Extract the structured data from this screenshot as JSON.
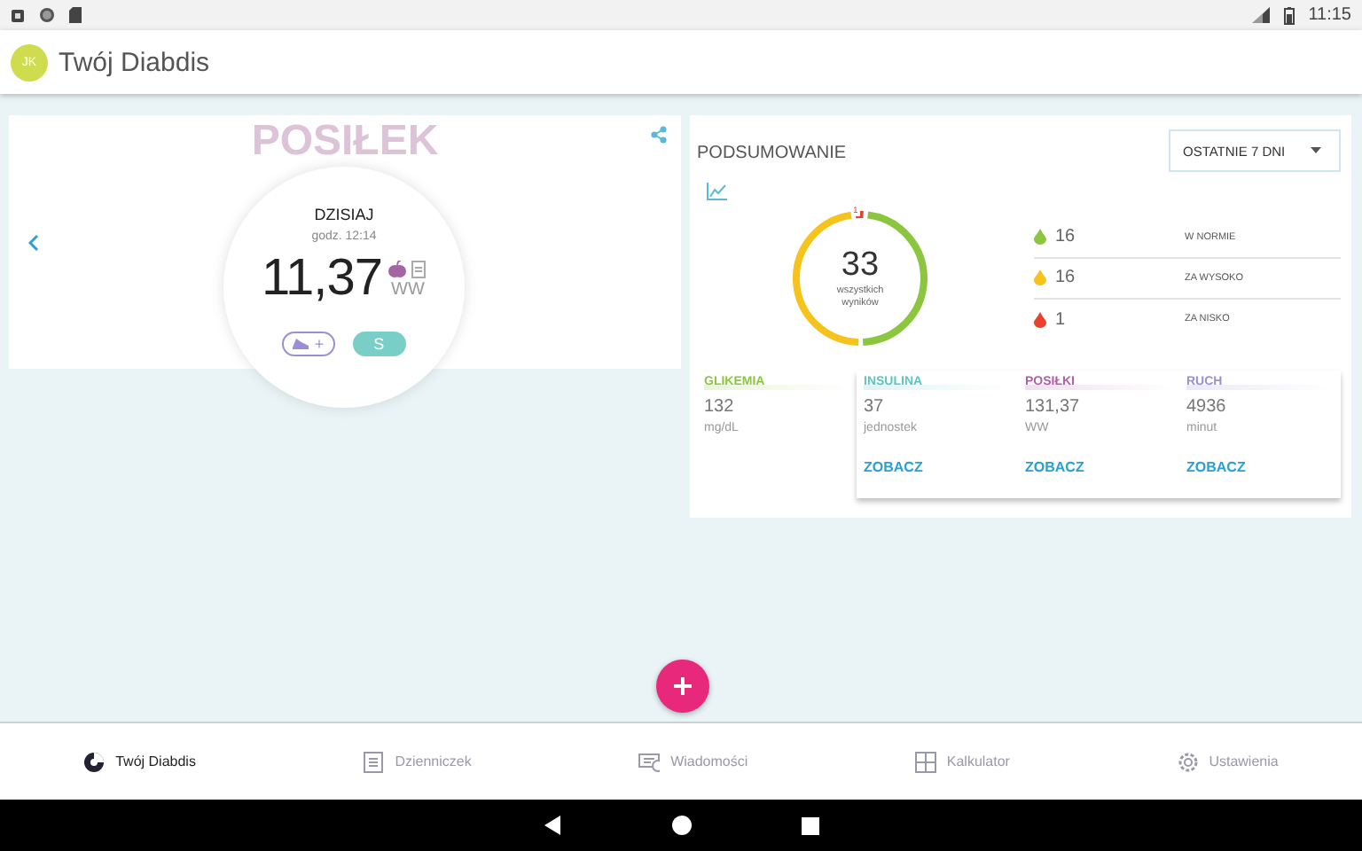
{
  "status_bar": {
    "time": "11:15"
  },
  "app_bar": {
    "avatar": "JK",
    "title": "Twój Diabdis"
  },
  "entry_card": {
    "category": "POSIŁEK",
    "day": "DZISIAJ",
    "time": "godz. 12:14",
    "value": "11,37",
    "unit": "WW",
    "tags": [
      {
        "kind": "activity",
        "label": "+"
      },
      {
        "kind": "note",
        "label": "S"
      }
    ]
  },
  "summary": {
    "title": "PODSUMOWANIE",
    "period": "OSTATNIE 7 DNI",
    "total": "33",
    "total_label": "wszystkich wyników",
    "ring_label": "1",
    "ranges": [
      {
        "count": "16",
        "label": "W NORMIE",
        "color": "#8cc63f"
      },
      {
        "count": "16",
        "label": "ZA WYSOKO",
        "color": "#f6c21c"
      },
      {
        "count": "1",
        "label": "ZA NISKO",
        "color": "#e8412c"
      }
    ],
    "metrics": [
      {
        "title": "GLIKEMIA",
        "value": "132",
        "unit": "mg/dL",
        "color": "#8cc63f"
      },
      {
        "title": "INSULINA",
        "value": "37",
        "unit": "jednostek",
        "color": "#5fc4c0",
        "link": "ZOBACZ"
      },
      {
        "title": "POSIŁKI",
        "value": "131,37",
        "unit": "WW",
        "color": "#b05ea8",
        "link": "ZOBACZ"
      },
      {
        "title": "RUCH",
        "value": "4936",
        "unit": "minut",
        "color": "#9b8fd4",
        "link": "ZOBACZ"
      }
    ]
  },
  "bottom_nav": [
    {
      "kind": "home",
      "label": "Twój Diabdis",
      "selected": true
    },
    {
      "kind": "diary",
      "label": "Dzienniczek",
      "selected": false
    },
    {
      "kind": "messages",
      "label": "Wiadomości",
      "selected": false
    },
    {
      "kind": "calculator",
      "label": "Kalkulator",
      "selected": false
    },
    {
      "kind": "settings",
      "label": "Ustawienia",
      "selected": false
    }
  ]
}
